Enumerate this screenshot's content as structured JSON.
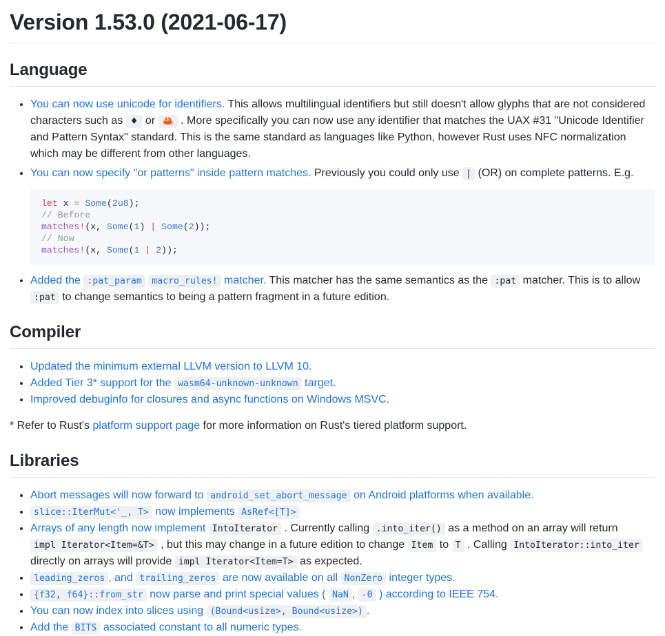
{
  "document": {
    "title": "Version 1.53.0 (2021-06-17)"
  },
  "sections": {
    "language": {
      "heading": "Language",
      "bullets": {
        "unicode": {
          "link": "You can now use unicode for identifiers.",
          "text_a": " This allows multilingual identifiers but still doesn't allow glyphs that are not considered characters such as ",
          "code_diamond": "♦",
          "text_or": " or ",
          "code_crab": "🦀",
          "text_b": " . More specifically you can now use any identifier that matches the UAX #31 \"Unicode Identifier and Pattern Syntax\" standard. This is the same standard as languages like Python, however Rust uses NFC normalization which may be different from other languages."
        },
        "or_patterns": {
          "link": "You can now specify \"or patterns\" inside pattern matches.",
          "text_a": " Previously you could only use ",
          "code_pipe": "|",
          "text_b": " (OR) on complete patterns. E.g."
        },
        "pat_param": {
          "link_a": "Added the ",
          "code_pat_param": ":pat_param",
          "code_macro_rules": "macro_rules!",
          "link_b": "matcher.",
          "text_a": " This matcher has the same semantics as the ",
          "code_pat_1": ":pat",
          "text_b": " matcher. This is to allow ",
          "code_pat_2": ":pat",
          "text_c": " to change semantics to being a pattern fragment in a future edition."
        }
      },
      "code_block": {
        "lines": [
          [
            {
              "t": "let",
              "c": "kw"
            },
            {
              "t": " x ",
              "c": "pl"
            },
            {
              "t": "=",
              "c": "op"
            },
            {
              "t": " ",
              "c": "pl"
            },
            {
              "t": "Some",
              "c": "ty"
            },
            {
              "t": "(",
              "c": "pl"
            },
            {
              "t": "2u8",
              "c": "num"
            },
            {
              "t": ");",
              "c": "pl"
            }
          ],
          [
            {
              "t": "// Before",
              "c": "cmt"
            }
          ],
          [
            {
              "t": "matches!",
              "c": "mac"
            },
            {
              "t": "(x, ",
              "c": "pl"
            },
            {
              "t": "Some",
              "c": "ty"
            },
            {
              "t": "(",
              "c": "pl"
            },
            {
              "t": "1",
              "c": "num"
            },
            {
              "t": ") ",
              "c": "pl"
            },
            {
              "t": "|",
              "c": "op"
            },
            {
              "t": " ",
              "c": "pl"
            },
            {
              "t": "Some",
              "c": "ty"
            },
            {
              "t": "(",
              "c": "pl"
            },
            {
              "t": "2",
              "c": "num"
            },
            {
              "t": "));",
              "c": "pl"
            }
          ],
          [
            {
              "t": "// Now",
              "c": "cmt"
            }
          ],
          [
            {
              "t": "matches!",
              "c": "mac"
            },
            {
              "t": "(x, ",
              "c": "pl"
            },
            {
              "t": "Some",
              "c": "ty"
            },
            {
              "t": "(",
              "c": "pl"
            },
            {
              "t": "1",
              "c": "num"
            },
            {
              "t": " ",
              "c": "pl"
            },
            {
              "t": "|",
              "c": "op"
            },
            {
              "t": " ",
              "c": "pl"
            },
            {
              "t": "2",
              "c": "num"
            },
            {
              "t": "));",
              "c": "pl"
            }
          ]
        ]
      }
    },
    "compiler": {
      "heading": "Compiler",
      "bullets": {
        "llvm": "Updated the minimum external LLVM version to LLVM 10.",
        "tier3": {
          "link_a": "Added Tier 3* support for the ",
          "code": "wasm64-unknown-unknown",
          "link_b": "target."
        },
        "debuginfo": "Improved debuginfo for closures and async functions on Windows MSVC."
      },
      "footnote": {
        "text_a": "* Refer to Rust's ",
        "link": "platform support page",
        "text_b": " for more information on Rust's tiered platform support."
      }
    },
    "libraries": {
      "heading": "Libraries",
      "bullets": {
        "abort": {
          "link_a": "Abort messages will now forward to ",
          "code": "android_set_abort_message",
          "link_b": "on Android platforms when available."
        },
        "itermut": {
          "code_a": "slice::IterMut<'_, T>",
          "link_mid": " now implements ",
          "code_b": "AsRef<[T]>"
        },
        "arrays": {
          "link_a": "Arrays of any length now implement ",
          "code_intoiterator": "IntoIterator",
          "text_a": " . Currently calling ",
          "code_into_iter": ".into_iter()",
          "text_b": " as a method on an array will return ",
          "code_impl_iter_ref": "impl Iterator<Item=&T>",
          "text_c": " , but this may change in a future edition to change ",
          "code_item": "Item",
          "text_d": " to ",
          "code_t": "T",
          "text_e": " . Calling ",
          "code_into_iter_path": "IntoIterator::into_iter",
          "text_f": " directly on arrays will provide ",
          "code_impl_iter_t": "impl Iterator<Item=T>",
          "text_g": " as expected."
        },
        "zeros": {
          "code_leading": "leading_zeros",
          "link_a": ", and ",
          "code_trailing": "trailing_zeros",
          "link_b": " are now available on all ",
          "code_nonzero": "NonZero",
          "link_c": " integer types."
        },
        "from_str": {
          "code_a": "{f32, f64}::from_str",
          "link_a": " now parse and print special values ( ",
          "code_nan": "NaN",
          "link_b": ", ",
          "code_negzero": "-0",
          "link_c": " ) according to IEEE 754."
        },
        "bound_index": {
          "link_a": "You can now index into slices using ",
          "code": "(Bound<usize>, Bound<usize>)",
          "link_b": "."
        },
        "bits": {
          "link_a": "Add the ",
          "code": "BITS",
          "link_b": " associated constant to all numeric types."
        }
      }
    }
  },
  "colors": {
    "link": "#1f74e0",
    "text": "#24292e",
    "code_bg": "#eef0f2",
    "codeblock_bg": "#f6f7f8",
    "rule": "#e3e5e8",
    "kw_red": "#d73a49",
    "type_blue": "#4078c8",
    "macro_purple": "#9b55c4",
    "comment_gray": "#999999"
  }
}
